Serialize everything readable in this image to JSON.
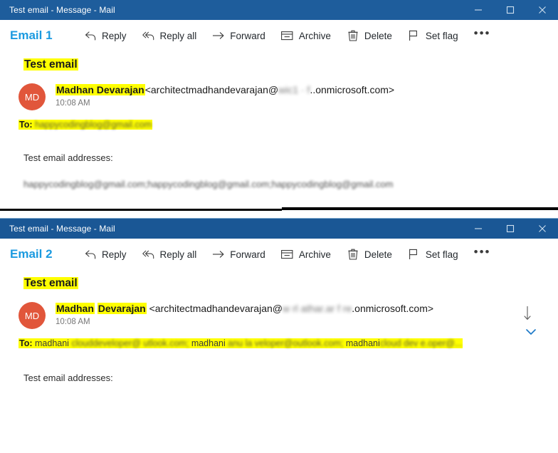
{
  "window1": {
    "titlebar": {
      "title": "Test email - Message - Mail",
      "minimize": "minimize",
      "maximize": "maximize",
      "close": "close"
    },
    "toolbar": {
      "email_label": "Email 1",
      "reply": "Reply",
      "reply_all": "Reply all",
      "forward": "Forward",
      "archive": "Archive",
      "delete": "Delete",
      "set_flag": "Set flag",
      "more": "•••"
    },
    "message": {
      "subject": "Test email",
      "avatar_initials": "MD",
      "sender_name": "Madhan Devarajan",
      "sender_email_open": "<architectmadhandevarajan@",
      "sender_email_blur": "wic1   ·    f",
      "sender_email_tail": "..onmicrosoft.com>",
      "time": "10:08 AM",
      "to_label": "To:",
      "to_address": "happycodingblog@gmail.com",
      "body_heading": "Test email addresses:",
      "body_addresses_part1": "happycodingblog@gmail.com;happycodingblog",
      "body_addresses_part2": "@gmail.com;happycodingblog@gmail.com"
    }
  },
  "window2": {
    "titlebar": {
      "title": "Test email - Message - Mail",
      "minimize": "minimize",
      "maximize": "maximize",
      "close": "close"
    },
    "toolbar": {
      "email_label": "Email 2",
      "reply": "Reply",
      "reply_all": "Reply all",
      "forward": "Forward",
      "archive": "Archive",
      "delete": "Delete",
      "set_flag": "Set flag",
      "more": "•••"
    },
    "message": {
      "subject": "Test email",
      "avatar_initials": "MD",
      "sender_name_first": "Madhan",
      "sender_name_last": "Devarajan",
      "sender_email_open": "<architectmadhandevarajan@",
      "sender_email_blur": "w rl athar.ar f re",
      "sender_email_tail": ".onmicrosoft.com>",
      "time": "10:08 AM",
      "to_label": "To:",
      "to_address_1": "madhani",
      "to_address_2": "clouddeveloper@",
      "to_address_3": "utlook.com;",
      "to_address_4": "madhani",
      "to_address_5": "anu la veloper@outlook.com;",
      "to_address_6": "madhani",
      "to_address_7": "cloud dev e.oper@...",
      "body_heading": "Test email addresses:"
    }
  },
  "colors": {
    "titlebar_bg": "#1e5d9c",
    "accent_blue": "#1b9ae0",
    "avatar_bg": "#e1563b",
    "highlight": "#ffff00",
    "chevron_blue": "#1e7ac8"
  }
}
